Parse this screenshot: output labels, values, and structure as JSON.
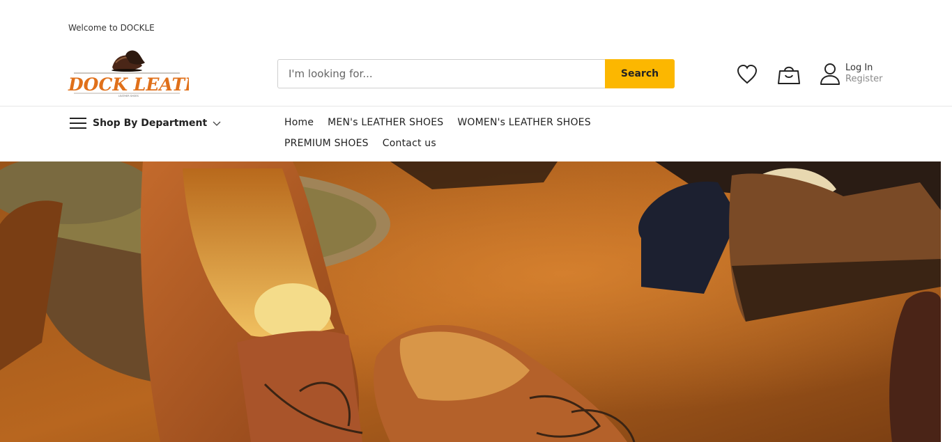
{
  "topbar": {
    "welcome": "Welcome to DOCKLE"
  },
  "brand": {
    "logo_text": "DOCK LEATHER",
    "logo_tagline": "LEATHER SHOES",
    "accent": "#e0701a"
  },
  "search": {
    "placeholder": "I'm looking for...",
    "button_label": "Search",
    "button_color": "#fcb700"
  },
  "header_icons": {
    "wishlist": "heart-icon",
    "cart": "shopping-bag-icon",
    "account": "user-icon"
  },
  "account": {
    "login_label": "Log In",
    "register_label": "Register"
  },
  "nav": {
    "department_label": "Shop By Department",
    "items": [
      {
        "label": "Home"
      },
      {
        "label": "MEN's LEATHER SHOES"
      },
      {
        "label": "WOMEN's LEATHER SHOES"
      },
      {
        "label": "PREMIUM SHOES"
      },
      {
        "label": "Contact us"
      }
    ]
  },
  "hero": {
    "description": "leather shoes banner image",
    "palette": [
      "#8a4a18",
      "#c7772f",
      "#3a2412"
    ]
  }
}
